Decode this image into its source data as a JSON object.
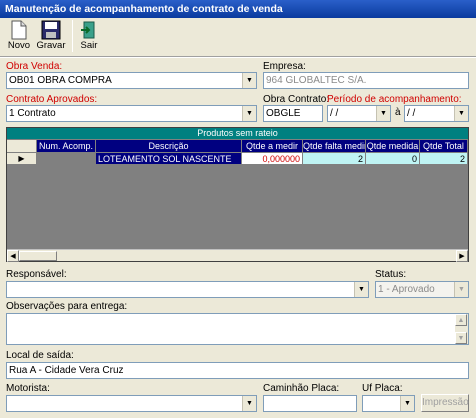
{
  "window": {
    "title": "Manutenção de acompanhamento de contrato de venda"
  },
  "toolbar": {
    "novo": "Novo",
    "gravar": "Gravar",
    "sair": "Sair"
  },
  "form": {
    "obra_venda": {
      "label": "Obra Venda:",
      "value": "OB01  OBRA COMPRA"
    },
    "empresa": {
      "label": "Empresa:",
      "value": "964 GLOBALTEC S/A."
    },
    "contrato": {
      "label": "Contrato Aprovados:",
      "value": "1  Contrato"
    },
    "obra_contrato": {
      "label": "Obra Contrato:",
      "value": "OBGLE"
    },
    "periodo": {
      "label": "Período de acompanhamento:",
      "start": " / /",
      "end": " / /",
      "sep": "à"
    },
    "responsavel": {
      "label": "Responsável:",
      "value": ""
    },
    "status": {
      "label": "Status:",
      "value": "1 - Aprovado"
    },
    "observacoes": {
      "label": "Observações para entrega:",
      "value": ""
    },
    "local_saida": {
      "label": "Local de saída:",
      "value": "Rua A - Cidade Vera Cruz"
    },
    "motorista": {
      "label": "Motorista:",
      "value": ""
    },
    "caminhao": {
      "label": "Caminhão Placa:",
      "value": ""
    },
    "uf_placa": {
      "label": "Uf Placa:",
      "value": ""
    },
    "impressao": "Impressão"
  },
  "grid": {
    "caption": "Produtos sem rateio",
    "columns": [
      "Num. Acomp.",
      "Descrição",
      "Qtde a medir",
      "Qtde falta medir",
      "Qtde medida",
      "Qtde Total"
    ],
    "rows": [
      {
        "num": "",
        "descricao": "LOTEAMENTO SOL NASCENTE",
        "a_medir": "0,000000",
        "falta_medir": "2",
        "medida": "0",
        "total": "2"
      }
    ]
  }
}
